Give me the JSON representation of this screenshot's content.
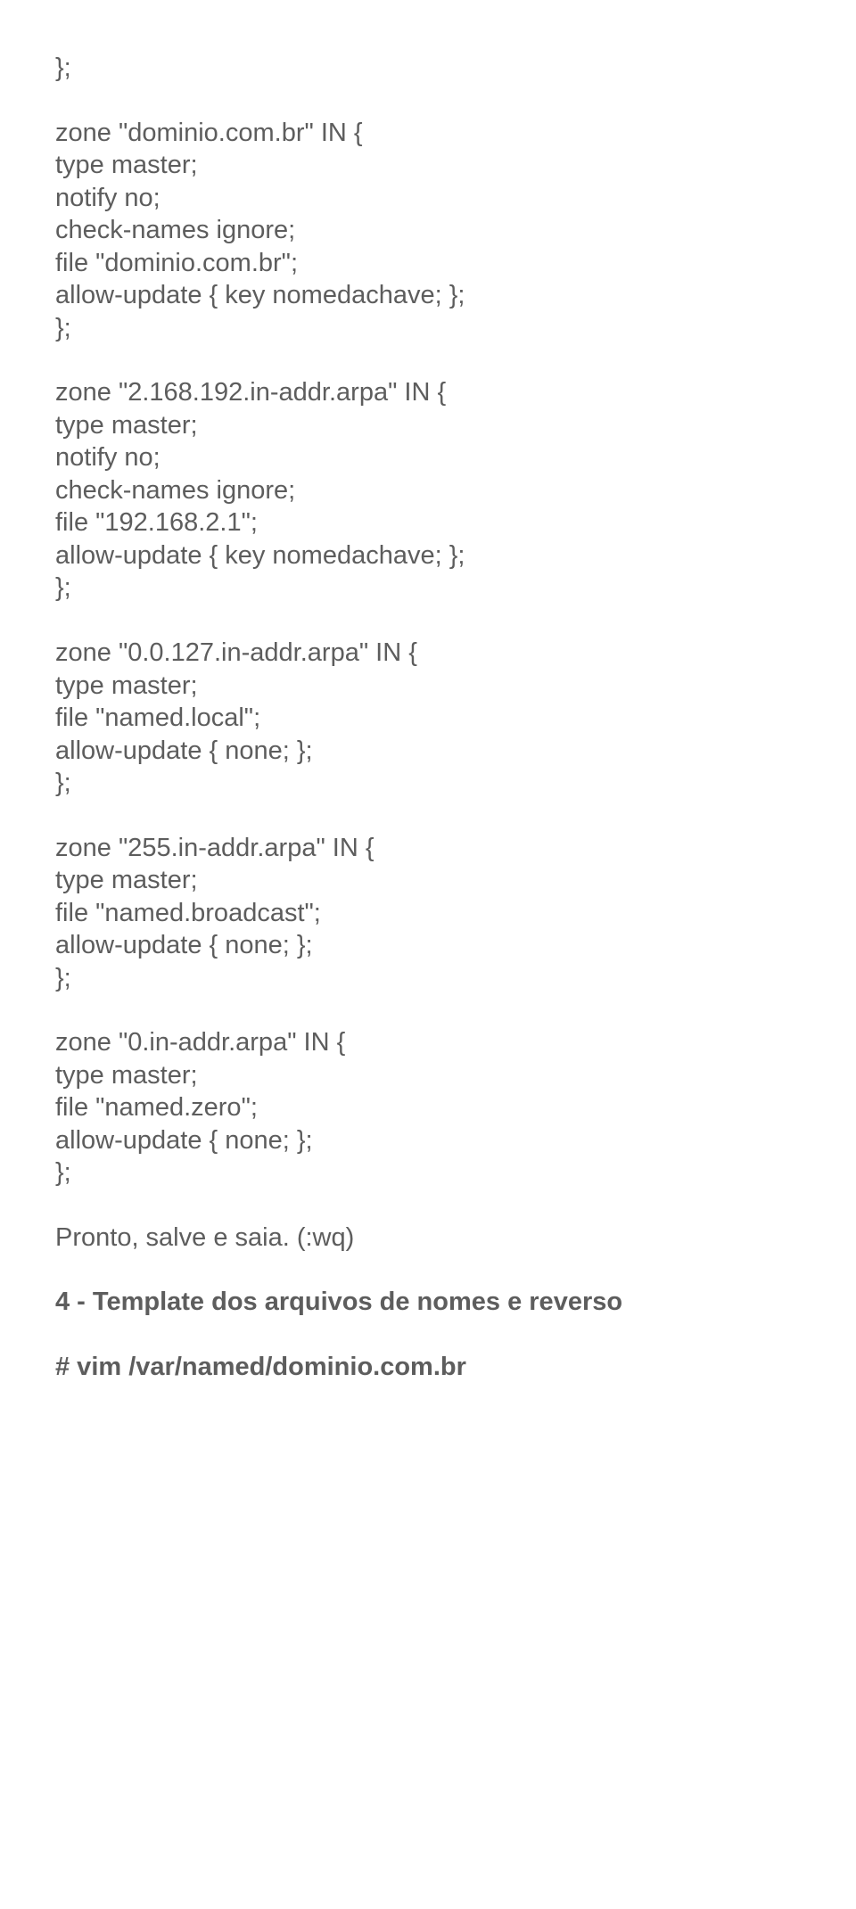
{
  "blocks": [
    {
      "lines": [
        "};"
      ]
    },
    {
      "lines": [
        "zone \"dominio.com.br\" IN {",
        "type master;",
        "notify no;",
        "check-names ignore;",
        "file \"dominio.com.br\";",
        "allow-update { key nomedachave; };",
        "};"
      ]
    },
    {
      "lines": [
        "zone \"2.168.192.in-addr.arpa\" IN {",
        "type master;",
        "notify no;",
        "check-names ignore;",
        "file \"192.168.2.1\";",
        "allow-update { key nomedachave; };",
        "};"
      ]
    },
    {
      "lines": [
        "zone \"0.0.127.in-addr.arpa\" IN {",
        "type master;",
        "file \"named.local\";",
        "allow-update { none; };",
        "};"
      ]
    },
    {
      "lines": [
        "zone \"255.in-addr.arpa\" IN {",
        "type master;",
        "file \"named.broadcast\";",
        "allow-update { none; };",
        "};"
      ]
    },
    {
      "lines": [
        "zone \"0.in-addr.arpa\" IN {",
        "type master;",
        "file \"named.zero\";",
        "allow-update { none; };",
        "};"
      ]
    },
    {
      "lines": [
        "Pronto, salve e saia. (:wq)"
      ]
    },
    {
      "lines": [
        "4 - Template dos arquivos de nomes e reverso"
      ],
      "bold": true
    },
    {
      "lines": [
        "# vim /var/named/dominio.com.br"
      ],
      "bold": true
    }
  ]
}
